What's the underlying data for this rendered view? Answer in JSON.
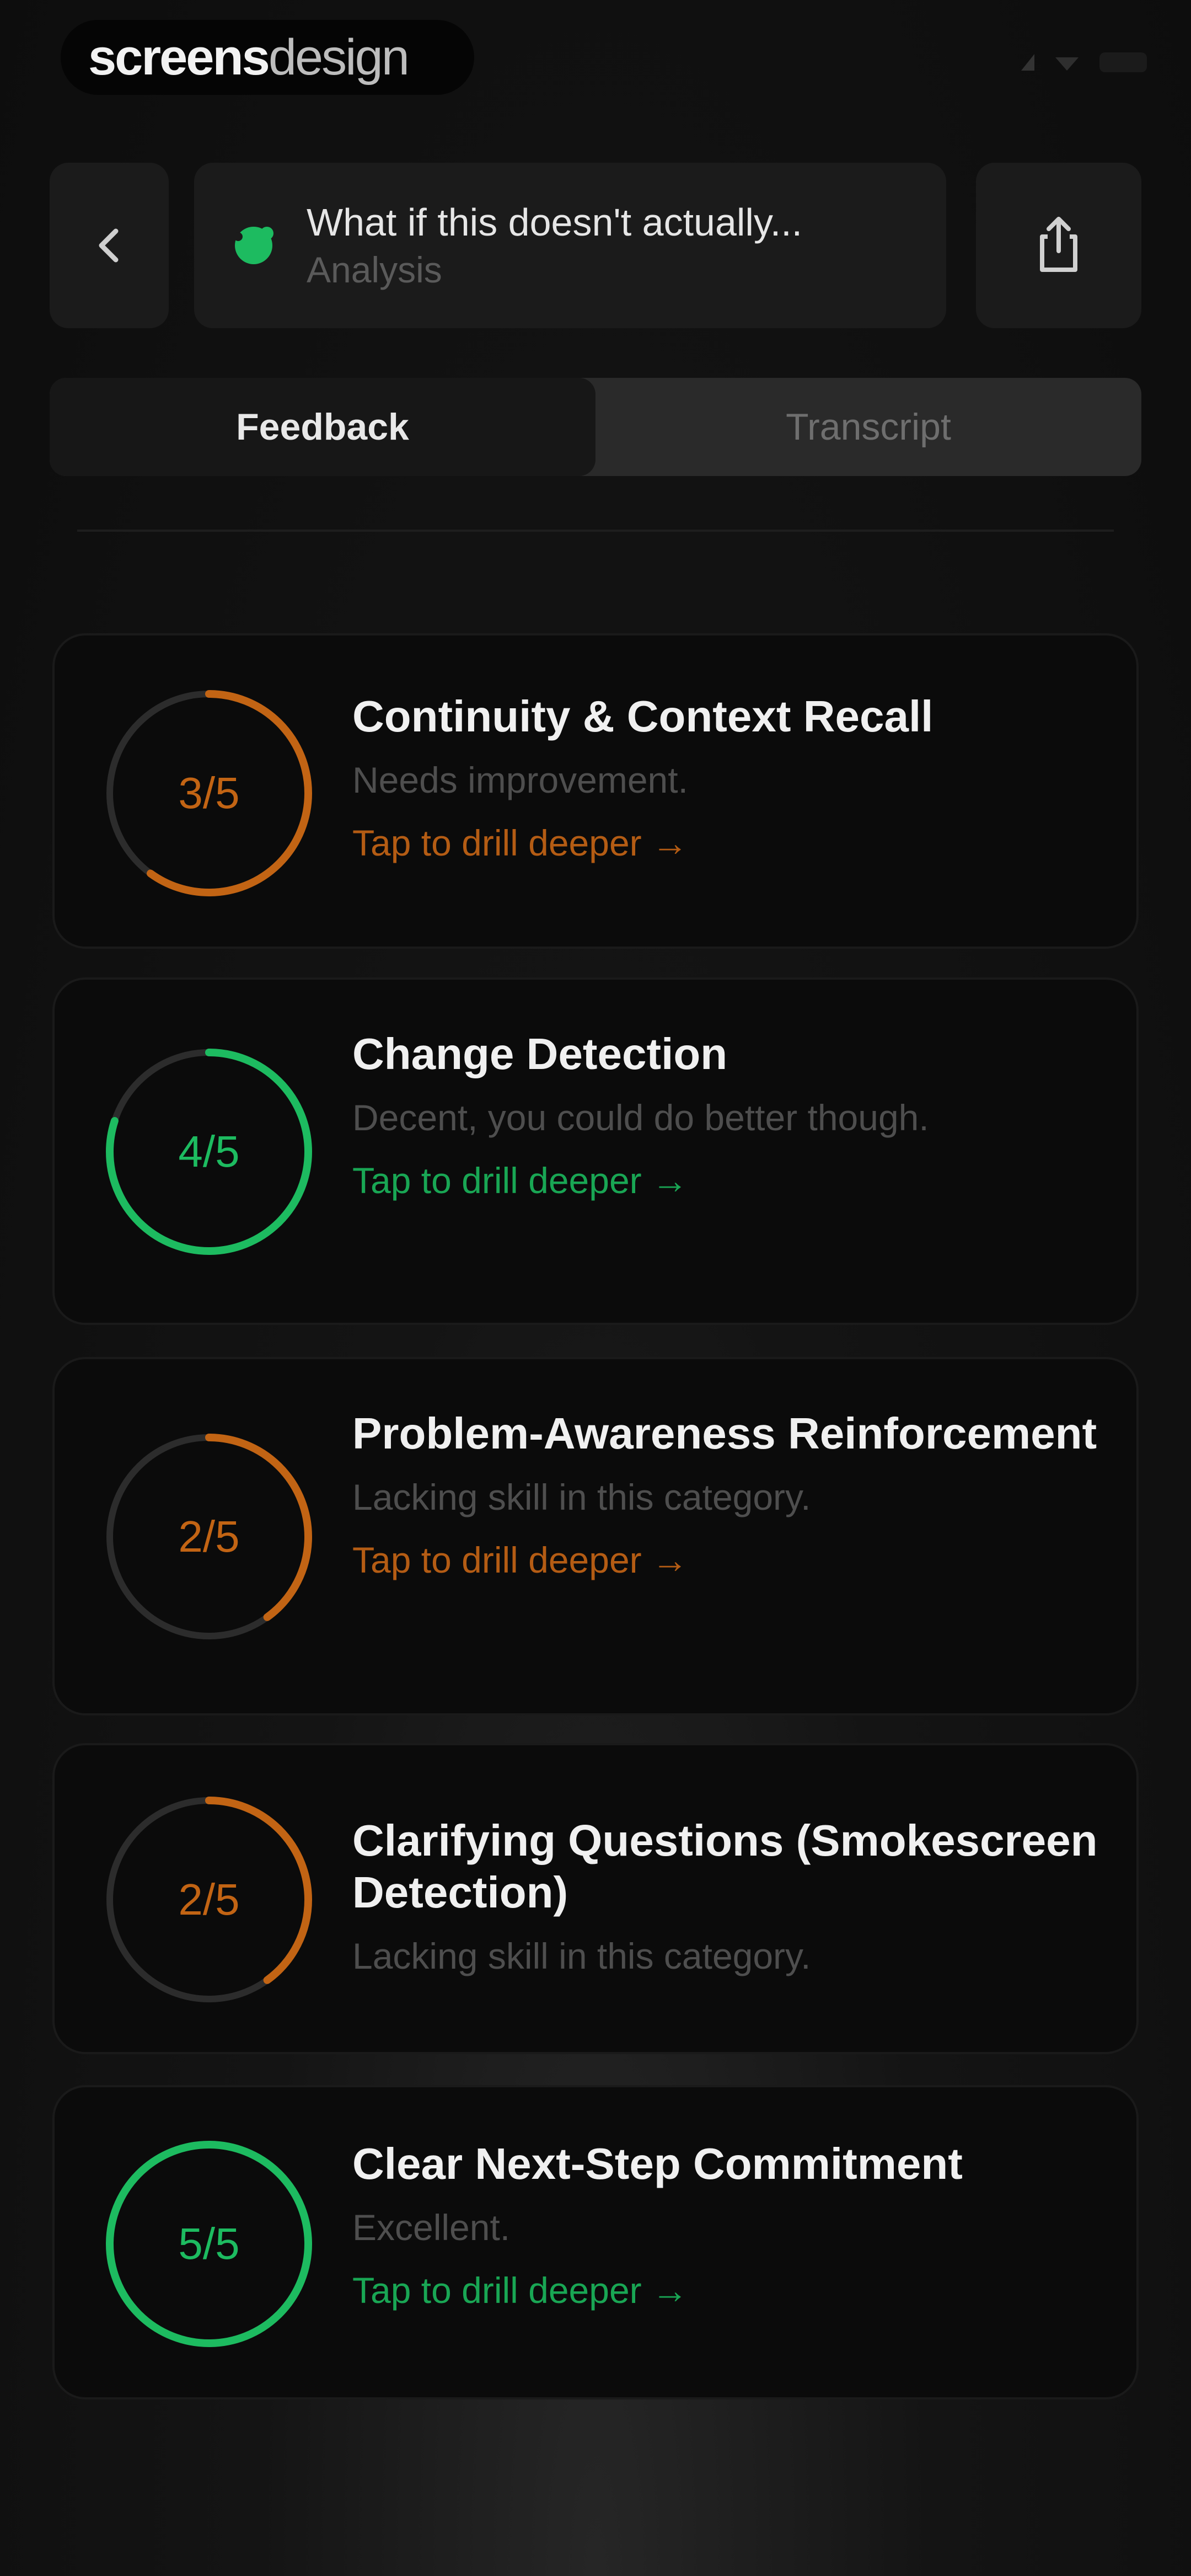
{
  "brand": {
    "bold": "screens",
    "light": "design"
  },
  "header": {
    "title": "What if this doesn't actually...",
    "subtitle": "Analysis",
    "back_icon": "chevron-left-icon",
    "share_icon": "share-icon",
    "status_dot_icon": "badge-icon"
  },
  "tabs": [
    {
      "label": "Feedback",
      "active": true
    },
    {
      "label": "Transcript",
      "active": false
    }
  ],
  "colors": {
    "orange": "#c26414",
    "green": "#1dbb60",
    "track": "#2c2c2c"
  },
  "cards": [
    {
      "score": 3,
      "max": 5,
      "score_label": "3/5",
      "title": "Continuity & Context Recall",
      "description": "Needs improvement.",
      "link": "Tap to drill deeper →",
      "tone": "orange"
    },
    {
      "score": 4,
      "max": 5,
      "score_label": "4/5",
      "title": "Change Detection",
      "description": "Decent, you could do better though.",
      "link": "Tap to drill deeper →",
      "tone": "green"
    },
    {
      "score": 2,
      "max": 5,
      "score_label": "2/5",
      "title": "Problem-Awareness Reinforcement",
      "description": "Lacking skill in this category.",
      "link": "Tap to drill deeper →",
      "tone": "orange"
    },
    {
      "score": 2,
      "max": 5,
      "score_label": "2/5",
      "title": "Clarifying Questions (Smokescreen Detection)",
      "description": "Lacking skill in this category.",
      "link": "",
      "tone": "orange"
    },
    {
      "score": 5,
      "max": 5,
      "score_label": "5/5",
      "title": "Clear Next-Step Commitment",
      "description": "Excellent.",
      "link": "Tap to drill deeper →",
      "tone": "green"
    }
  ]
}
